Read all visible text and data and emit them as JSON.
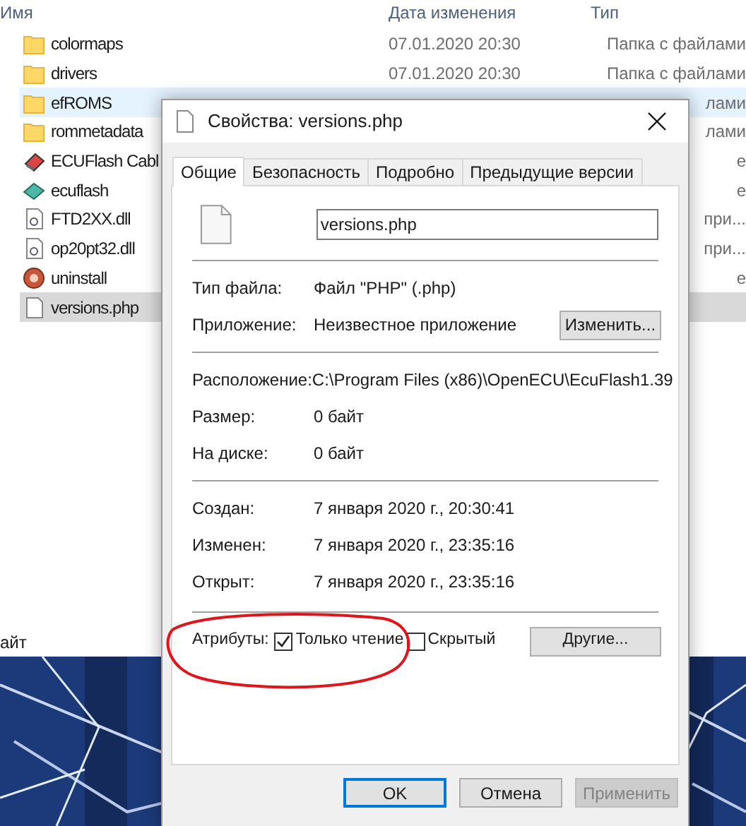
{
  "explorer": {
    "columns": [
      "Имя",
      "Дата изменения",
      "Тип"
    ],
    "rows": [
      {
        "name": "colormaps",
        "kind": "folder",
        "date": "07.01.2020 20:30",
        "type": "Папка с файлами",
        "selected": false,
        "hovered": false
      },
      {
        "name": "drivers",
        "kind": "folder",
        "date": "07.01.2020 20:30",
        "type": "Папка с файлами",
        "selected": false,
        "hovered": false
      },
      {
        "name": "efROMS",
        "kind": "folder",
        "type": "лами",
        "selected": false,
        "hovered": true
      },
      {
        "name": "rommetadata",
        "kind": "folder",
        "type": "лами",
        "selected": false,
        "hovered": false
      },
      {
        "name": "ECUFlash Cabl",
        "kind": "tool",
        "type": "е",
        "selected": false,
        "hovered": false
      },
      {
        "name": "ecuflash",
        "kind": "chip",
        "type": "е",
        "selected": false,
        "hovered": false
      },
      {
        "name": "FTD2XX.dll",
        "kind": "dll",
        "type": "при...",
        "selected": false,
        "hovered": false
      },
      {
        "name": "op20pt32.dll",
        "kind": "dll",
        "type": "при...",
        "selected": false,
        "hovered": false
      },
      {
        "name": "uninstall",
        "kind": "uninstall",
        "type": "е",
        "selected": false,
        "hovered": false
      },
      {
        "name": "versions.php",
        "kind": "file",
        "selected": true,
        "hovered": false
      }
    ],
    "status_bar": "айт"
  },
  "dialog": {
    "title": "Свойства: versions.php",
    "tabs": [
      {
        "label": "Общие",
        "selected": true
      },
      {
        "label": "Безопасность",
        "selected": false
      },
      {
        "label": "Подробно",
        "selected": false
      },
      {
        "label": "Предыдущие версии",
        "selected": false
      }
    ],
    "file_name": "versions.php",
    "groups": [
      [
        {
          "label": "Тип файла:",
          "value": "Файл \"PHP\" (.php)"
        },
        {
          "label": "Приложение:",
          "value": "Неизвестное приложение",
          "button": "Изменить..."
        }
      ],
      [
        {
          "label": "Расположение:",
          "value": "C:\\Program Files (x86)\\OpenECU\\EcuFlash1.39"
        },
        {
          "label": "Размер:",
          "value": "0 байт"
        },
        {
          "label": "На диске:",
          "value": "0 байт"
        }
      ],
      [
        {
          "label": "Создан:",
          "value": "7 января 2020 г., 20:30:41"
        },
        {
          "label": "Изменен:",
          "value": "7 января 2020 г., 23:35:16"
        },
        {
          "label": "Открыт:",
          "value": "7 января 2020 г., 23:35:16"
        }
      ]
    ],
    "attributes": {
      "label": "Атрибуты:",
      "checkboxes": [
        {
          "label": "Только чтение",
          "checked": true
        },
        {
          "label": "Скрытый",
          "checked": false
        }
      ],
      "button": "Другие..."
    },
    "buttons": [
      {
        "label": "OK",
        "default": true,
        "disabled": false
      },
      {
        "label": "Отмена",
        "default": false,
        "disabled": false
      },
      {
        "label": "Применить",
        "default": false,
        "disabled": true
      }
    ]
  }
}
